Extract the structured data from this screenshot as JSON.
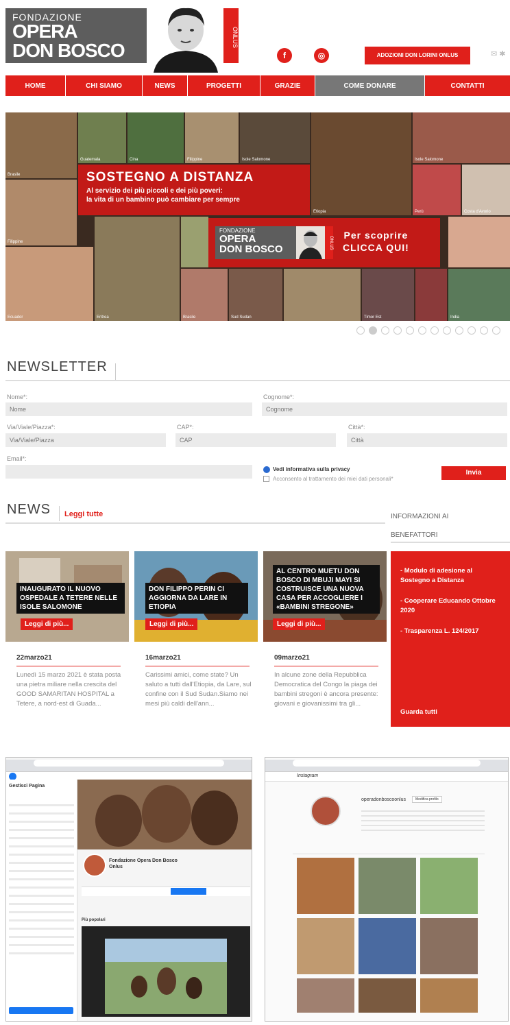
{
  "header": {
    "logo": {
      "line1": "FONDAZIONE",
      "line2": "OPERA",
      "line3": "DON BOSCO"
    },
    "onlus": "ONLUS",
    "adopt_button": "ADOZIONI DON LORINI ONLUS",
    "social": [
      {
        "icon": "facebook-icon",
        "glyph": "f"
      },
      {
        "icon": "instagram-icon",
        "glyph": "◎"
      }
    ]
  },
  "nav": [
    {
      "label": "HOME"
    },
    {
      "label": "CHI SIAMO"
    },
    {
      "label": "NEWS"
    },
    {
      "label": "PROGETTI"
    },
    {
      "label": "GRAZIE"
    },
    {
      "label": "COME DONARE",
      "active": true
    },
    {
      "label": "CONTATTI"
    }
  ],
  "hero": {
    "title": "SOSTEGNO A DISTANZA",
    "subtitle1": "Al servizio dei più piccoli e dei più poveri:",
    "subtitle2": "la vita di un bambino può cambiare per sempre",
    "cta_logo": {
      "line1": "FONDAZIONE",
      "line2": "OPERA",
      "line3": "DON BOSCO",
      "onlus": "ONLUS"
    },
    "cta_line1": "Per scoprire",
    "cta_line2": "CLICCA QUI!",
    "labels": [
      "Brasile",
      "Guatemala",
      "Cina",
      "Filippine",
      "Isole Salomone",
      "Etiopia",
      "Filippine",
      "Ecuador",
      "Brasile",
      "Sud Sudan",
      "Costa d'Avorio",
      "Perù",
      "Timor Est",
      "Eritrea",
      "India"
    ],
    "dots": 12
  },
  "newsletter": {
    "title": "NEWSLETTER",
    "fields": [
      {
        "label": "Nome*:",
        "placeholder": "Nome"
      },
      {
        "label": "Cognome*:",
        "placeholder": "Cognome"
      },
      {
        "label": "Via/Viale/Piazza*:",
        "placeholder": "Via/Viale/Piazza"
      },
      {
        "label": "CAP*:",
        "placeholder": "CAP"
      },
      {
        "label": "Città*:",
        "placeholder": "Città"
      },
      {
        "label": "Email*:",
        "placeholder": ""
      }
    ],
    "privacy_title": "Vedi informativa sulla privacy",
    "privacy_consent": "Acconsento al trattamento dei miei dati personali*",
    "submit": "Invia"
  },
  "news": {
    "title": "NEWS",
    "read_all": "Leggi tutte",
    "read_more": "Leggi di più...",
    "items": [
      {
        "caption": "INAUGURATO IL NUOVO OSPEDALE A TETERE NELLE ISOLE SALOMONE",
        "date": "22marzo21",
        "text": "Lunedì 15 marzo 2021 è stata posta una pietra miliare nella crescita del GOOD SAMARITAN HOSPITAL a Tetere, a nord-est di Guada..."
      },
      {
        "caption": "DON FILIPPO PERIN CI AGGIORNA DA LARE IN ETIOPIA",
        "date": "16marzo21",
        "text": "Carissimi amici, come state? Un saluto a tutti dall'Etiopia, da Lare, sul confine con il Sud Sudan.Siamo nei mesi più caldi dell'ann..."
      },
      {
        "caption": "AL CENTRO MUETU DON BOSCO DI MBUJI MAYI SI COSTRUISCE UNA NUOVA CASA PER ACCOGLIERE I «BAMBINI STREGONE»",
        "date": "09marzo21",
        "text": "In alcune zone della Repubblica Democratica del Congo la piaga dei bambini stregoni è ancora presente: giovani e giovanissimi tra gli..."
      }
    ]
  },
  "sidebar": {
    "title_line1": "INFORMAZIONI AI",
    "title_line2": "BENEFATTORI",
    "links": [
      "- Modulo di adesione al Sostegno a Distanza",
      "- Cooperare Educando Ottobre 2020",
      "- Trasparenza L. 124/2017"
    ],
    "see_all": "Guarda tutti"
  },
  "screenshots": {
    "facebook": {
      "page_name": "Fondazione Opera Don Bosco Onlus",
      "section": "Gestisci Pagina",
      "tab": "Più popolari"
    },
    "instagram": {
      "logo": "Instagram",
      "handle": "operadonboscoonlus",
      "follow": "Modifica profilo"
    }
  },
  "colors": {
    "accent": "#e0201b",
    "dark_gray": "#5d5d5d"
  }
}
